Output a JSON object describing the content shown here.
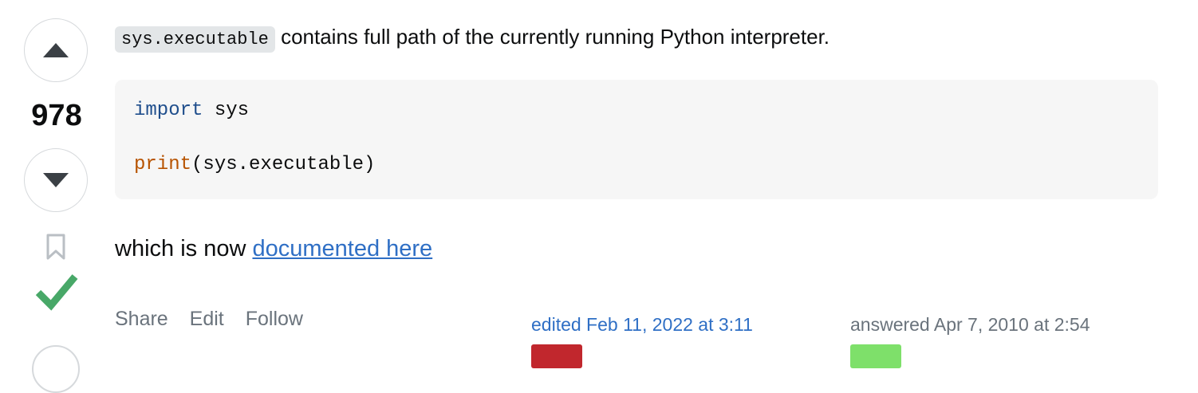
{
  "vote": {
    "count": "978",
    "upvote_icon": "triangle-up-icon",
    "downvote_icon": "triangle-down-icon",
    "bookmark_icon": "bookmark-icon",
    "accepted_icon": "checkmark-icon",
    "accepted_color": "#48a868"
  },
  "answer": {
    "p1_code": "sys.executable",
    "p1_text": " contains full path of the currently running Python interpreter.",
    "code": {
      "line1_kw": "import",
      "line1_rest": " sys",
      "line3_fn": "print",
      "line3_rest": "(sys.executable)"
    },
    "p2_text": "which is now ",
    "p2_link": "documented here"
  },
  "footer": {
    "share": "Share",
    "edit": "Edit",
    "follow": "Follow",
    "edited": "edited Feb 11, 2022 at 3:11",
    "answered": "answered Apr 7, 2010 at 2:54"
  },
  "colors": {
    "link": "#2f6fc5",
    "keyword": "#1f4e8c",
    "function": "#b75301"
  }
}
